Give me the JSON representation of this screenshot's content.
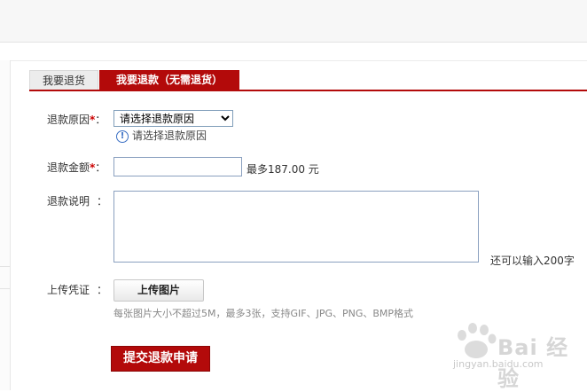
{
  "tabs": [
    {
      "label": "我要退货",
      "active": false
    },
    {
      "label": "我要退款（无需退货）",
      "active": true
    }
  ],
  "form": {
    "reason_label": "退款原因",
    "required_mark": "*",
    "colon": "：",
    "reason_select_value": "请选择退款原因",
    "reason_hint": "请选择退款原因",
    "amount_label": "退款金额",
    "amount_value": "",
    "amount_max": "最多187.00 元",
    "note_label": "退款说明",
    "note_value": "",
    "note_remaining": "还可以输入200字",
    "upload_label": "上传凭证",
    "upload_button": "上传图片",
    "upload_tip": "每张图片大小不超过5M，最多3张，支持GIF、JPG、PNG、BMP格式",
    "submit_button": "提交退款申请"
  },
  "watermark": {
    "text": "Bai 经验",
    "url": "jingyan.baidu.com"
  },
  "colors": {
    "accent": "#b30a0a",
    "required": "#cc0000",
    "hint_icon": "#3a6fc4"
  }
}
